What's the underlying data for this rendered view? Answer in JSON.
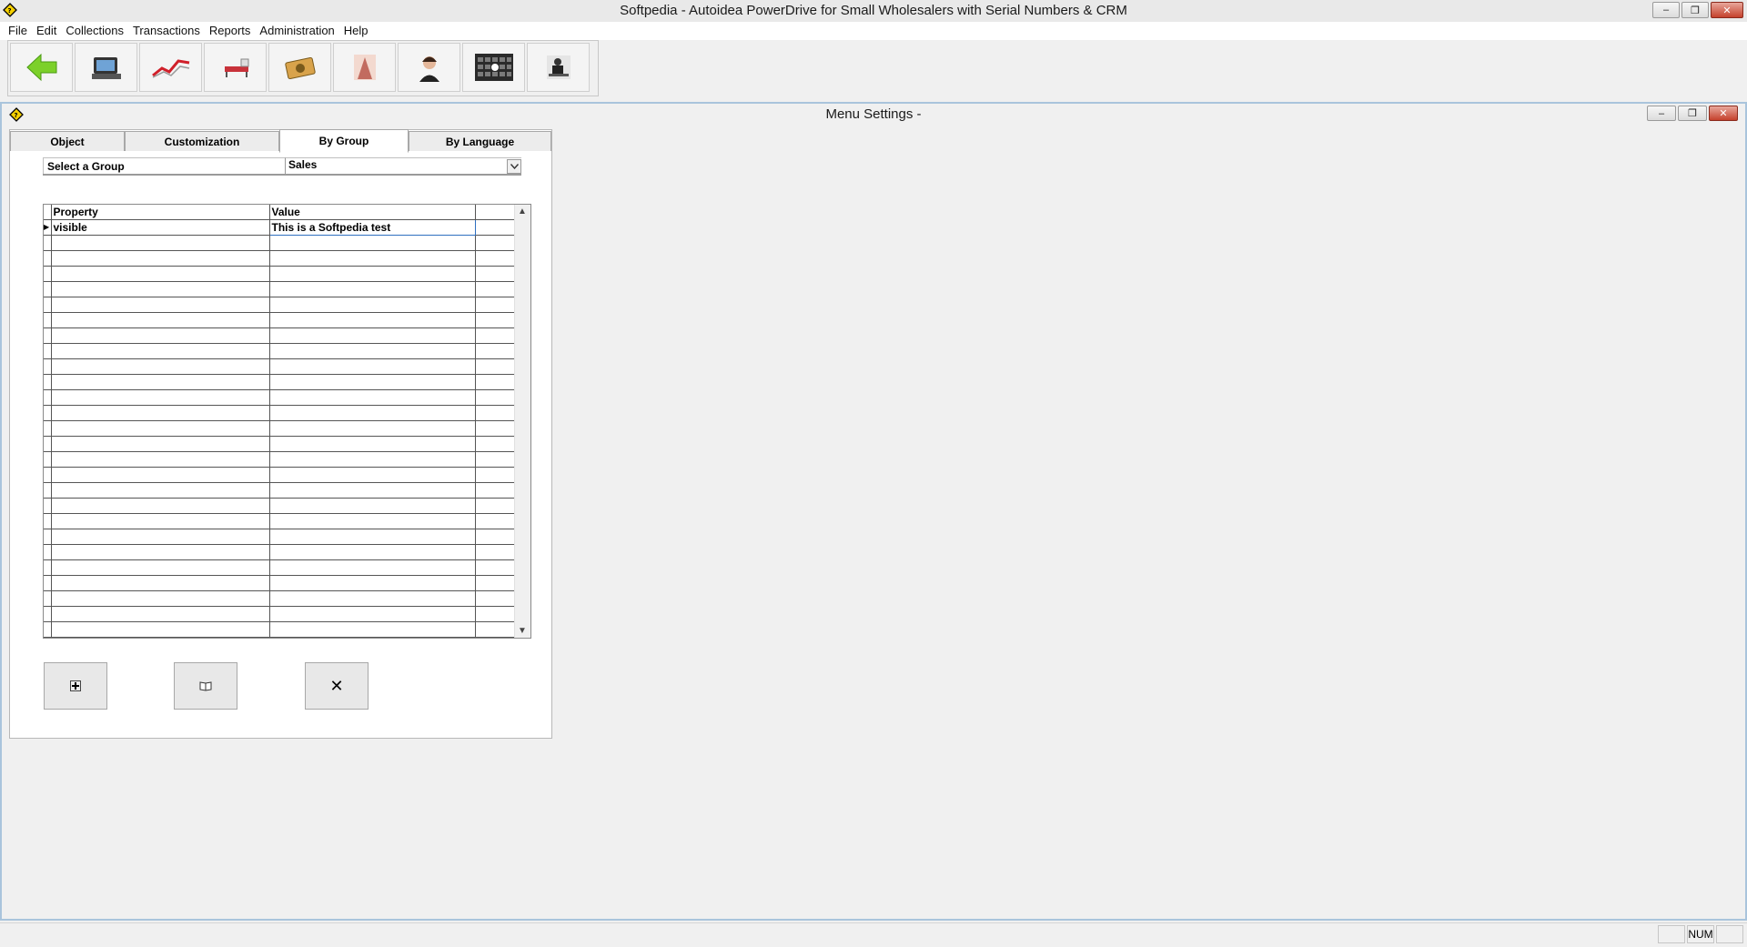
{
  "window": {
    "title": "Softpedia - Autoidea PowerDrive for Small Wholesalers with Serial Numbers & CRM",
    "minimize": "–",
    "restore": "❐",
    "close": "✕"
  },
  "menu": [
    "File",
    "Edit",
    "Collections",
    "Transactions",
    "Reports",
    "Administration",
    "Help"
  ],
  "toolbar": {
    "buttons": [
      "back-arrow-icon",
      "pos-terminal-icon",
      "sales-chart-icon",
      "shipping-icon",
      "money-icon",
      "person-icon",
      "support-agent-icon",
      "keyboard-icon",
      "office-worker-icon"
    ]
  },
  "child": {
    "title": "Menu Settings -",
    "minimize": "–",
    "restore": "❐",
    "close": "✕"
  },
  "tabs": [
    "Object",
    "Customization",
    "By Group",
    "By Language"
  ],
  "active_tab": "By Group",
  "group": {
    "label": "Select a Group",
    "value": "Sales",
    "dropdown_glyph": "⌄"
  },
  "grid": {
    "headers": [
      "Property",
      "Value"
    ],
    "rows": [
      {
        "indicator": "▶",
        "property": "visible",
        "value": "This is a Softpedia test"
      }
    ],
    "empty_rows": 26,
    "scroll_up": "▲",
    "scroll_down": "▼"
  },
  "actions": {
    "add": "add-record-icon",
    "open": "book-icon",
    "delete": "✕"
  },
  "status": {
    "num": "NUM"
  },
  "colors": {
    "accent_border": "#a9c4dc",
    "selection": "#2f6fc0",
    "close_red": "#c5412c"
  }
}
